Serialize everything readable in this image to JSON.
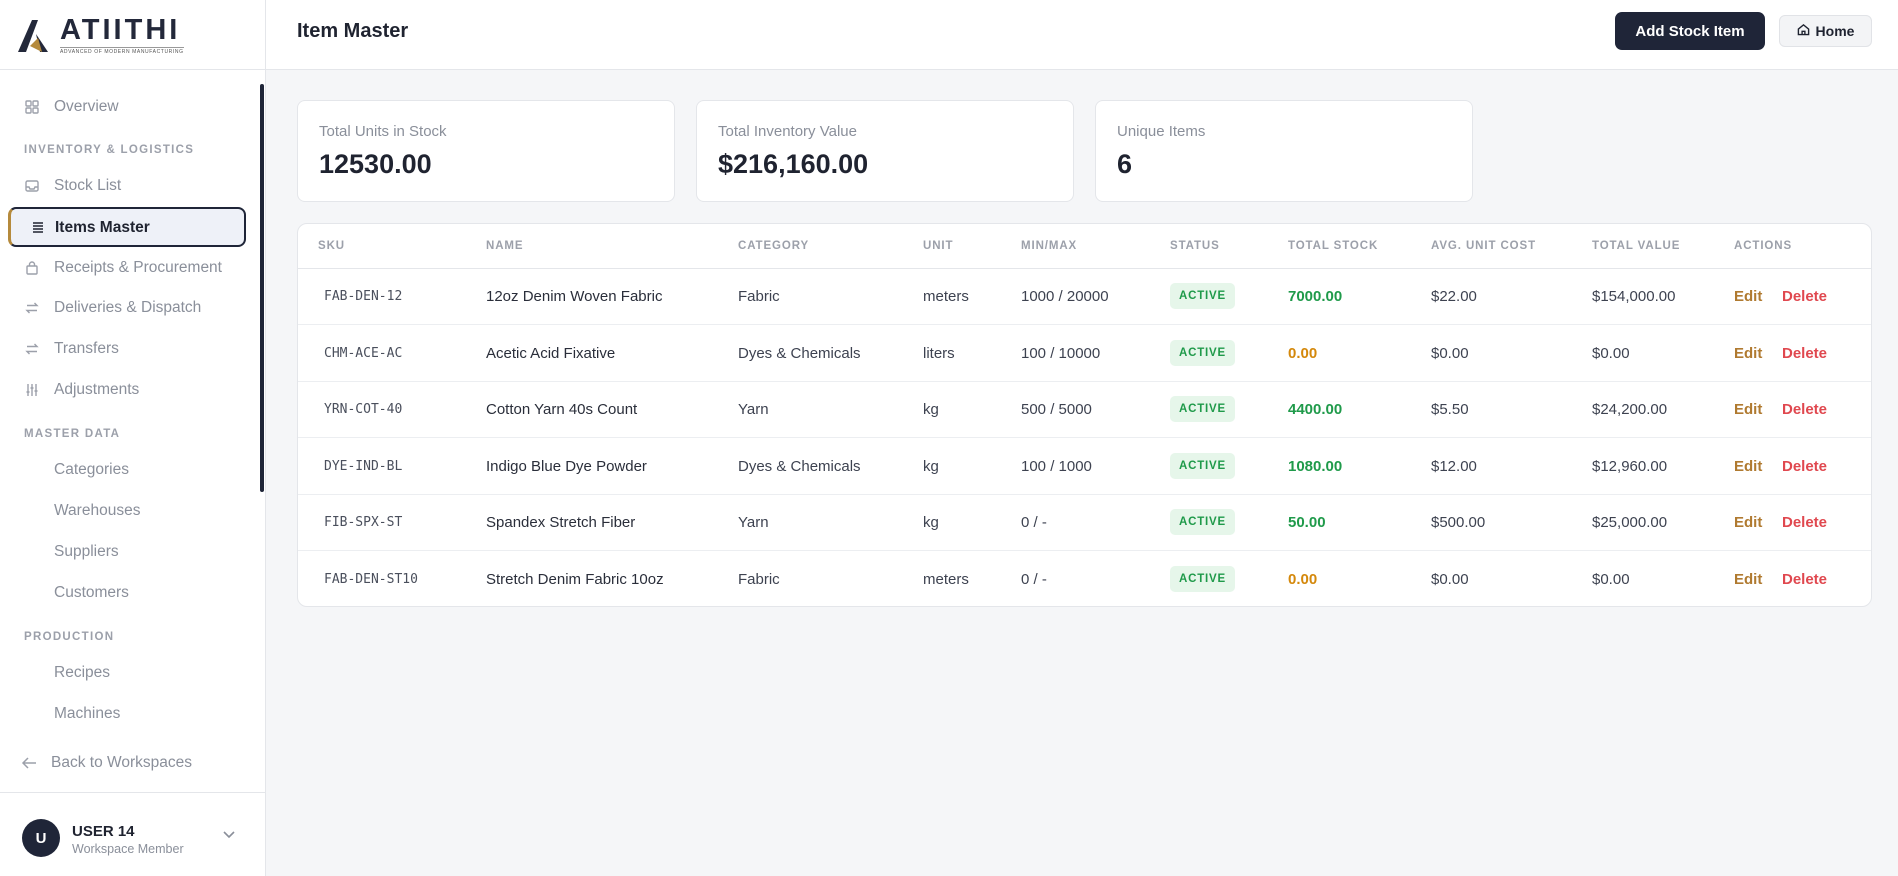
{
  "brand": {
    "name": "ATIITHI",
    "tagline": "ADVANCED OF MODERN MANUFACTURING"
  },
  "sidebar": {
    "overview": "Overview",
    "sections": {
      "inventory": "INVENTORY & LOGISTICS",
      "master": "MASTER DATA",
      "production": "PRODUCTION"
    },
    "items": {
      "stock_list": "Stock List",
      "items_master": "Items Master",
      "receipts": "Receipts & Procurement",
      "deliveries": "Deliveries & Dispatch",
      "transfers": "Transfers",
      "adjustments": "Adjustments",
      "categories": "Categories",
      "warehouses": "Warehouses",
      "suppliers": "Suppliers",
      "customers": "Customers",
      "recipes": "Recipes",
      "machines": "Machines"
    },
    "back": "Back to Workspaces",
    "user": {
      "initial": "U",
      "name": "USER 14",
      "role": "Workspace Member"
    }
  },
  "header": {
    "title": "Item Master",
    "add_button": "Add Stock Item",
    "home_button": "Home"
  },
  "stats": [
    {
      "label": "Total Units in Stock",
      "value": "12530.00"
    },
    {
      "label": "Total Inventory Value",
      "value": "$216,160.00"
    },
    {
      "label": "Unique Items",
      "value": "6"
    }
  ],
  "table": {
    "columns": [
      "SKU",
      "NAME",
      "CATEGORY",
      "UNIT",
      "MIN/MAX",
      "STATUS",
      "TOTAL STOCK",
      "AVG. UNIT COST",
      "TOTAL VALUE",
      "ACTIONS"
    ],
    "rows": [
      {
        "sku": "FAB-DEN-12",
        "name": "12oz Denim Woven Fabric",
        "category": "Fabric",
        "unit": "meters",
        "minmax": "1000 / 20000",
        "status": "ACTIVE",
        "stock": "7000.00",
        "stock_level": "ok",
        "cost": "$22.00",
        "value": "$154,000.00"
      },
      {
        "sku": "CHM-ACE-AC",
        "name": "Acetic Acid Fixative",
        "category": "Dyes & Chemicals",
        "unit": "liters",
        "minmax": "100 / 10000",
        "status": "ACTIVE",
        "stock": "0.00",
        "stock_level": "low",
        "cost": "$0.00",
        "value": "$0.00"
      },
      {
        "sku": "YRN-COT-40",
        "name": "Cotton Yarn 40s Count",
        "category": "Yarn",
        "unit": "kg",
        "minmax": "500 / 5000",
        "status": "ACTIVE",
        "stock": "4400.00",
        "stock_level": "ok",
        "cost": "$5.50",
        "value": "$24,200.00"
      },
      {
        "sku": "DYE-IND-BL",
        "name": "Indigo Blue Dye Powder",
        "category": "Dyes & Chemicals",
        "unit": "kg",
        "minmax": "100 / 1000",
        "status": "ACTIVE",
        "stock": "1080.00",
        "stock_level": "ok",
        "cost": "$12.00",
        "value": "$12,960.00"
      },
      {
        "sku": "FIB-SPX-ST",
        "name": "Spandex Stretch Fiber",
        "category": "Yarn",
        "unit": "kg",
        "minmax": "0 / -",
        "status": "ACTIVE",
        "stock": "50.00",
        "stock_level": "ok",
        "cost": "$500.00",
        "value": "$25,000.00"
      },
      {
        "sku": "FAB-DEN-ST10",
        "name": "Stretch Denim Fabric 10oz",
        "category": "Fabric",
        "unit": "meters",
        "minmax": "0 / -",
        "status": "ACTIVE",
        "stock": "0.00",
        "stock_level": "low",
        "cost": "$0.00",
        "value": "$0.00"
      }
    ],
    "actions": {
      "edit": "Edit",
      "delete": "Delete"
    }
  },
  "colors": {
    "primary": "#1f2538",
    "accent": "#b58a3c",
    "ok": "#1f9a4a",
    "low": "#d4880b",
    "danger": "#e0484f"
  }
}
